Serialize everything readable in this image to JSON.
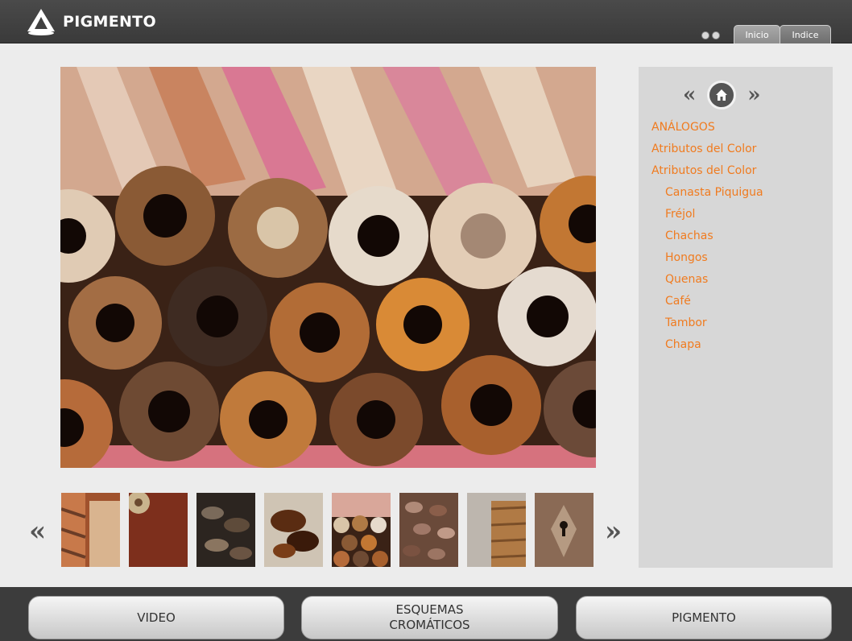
{
  "header": {
    "brand": "PIGMENTO",
    "tabs": [
      "Inicio",
      "Indice"
    ]
  },
  "side_panel": {
    "nav": {
      "prev": "«",
      "next": "»"
    },
    "items": [
      {
        "label": "ANÁLOGOS",
        "level": 0
      },
      {
        "label": "Atributos del Color",
        "level": 0
      },
      {
        "label": "Atributos del Color",
        "level": 0
      },
      {
        "label": "Canasta Piquigua",
        "level": 1
      },
      {
        "label": "Fréjol",
        "level": 1
      },
      {
        "label": "Chachas",
        "level": 1
      },
      {
        "label": "Hongos",
        "level": 1
      },
      {
        "label": "Quenas",
        "level": 1
      },
      {
        "label": "Café",
        "level": 1
      },
      {
        "label": "Tambor",
        "level": 1
      },
      {
        "label": "Chapa",
        "level": 1
      }
    ]
  },
  "gallery": {
    "prev": "«",
    "next": "»",
    "thumbnails": [
      "canasta",
      "frejol",
      "chachas",
      "hongos",
      "quenas",
      "cafe",
      "tambor",
      "chapa"
    ]
  },
  "footer": {
    "video": "VIDEO",
    "esquemas_line1": "ESQUEMAS",
    "esquemas_line2": "CROMÁTICOS",
    "pigmento": "PIGMENTO"
  },
  "colors": {
    "accent": "#f07b1f",
    "header": "#404040"
  }
}
